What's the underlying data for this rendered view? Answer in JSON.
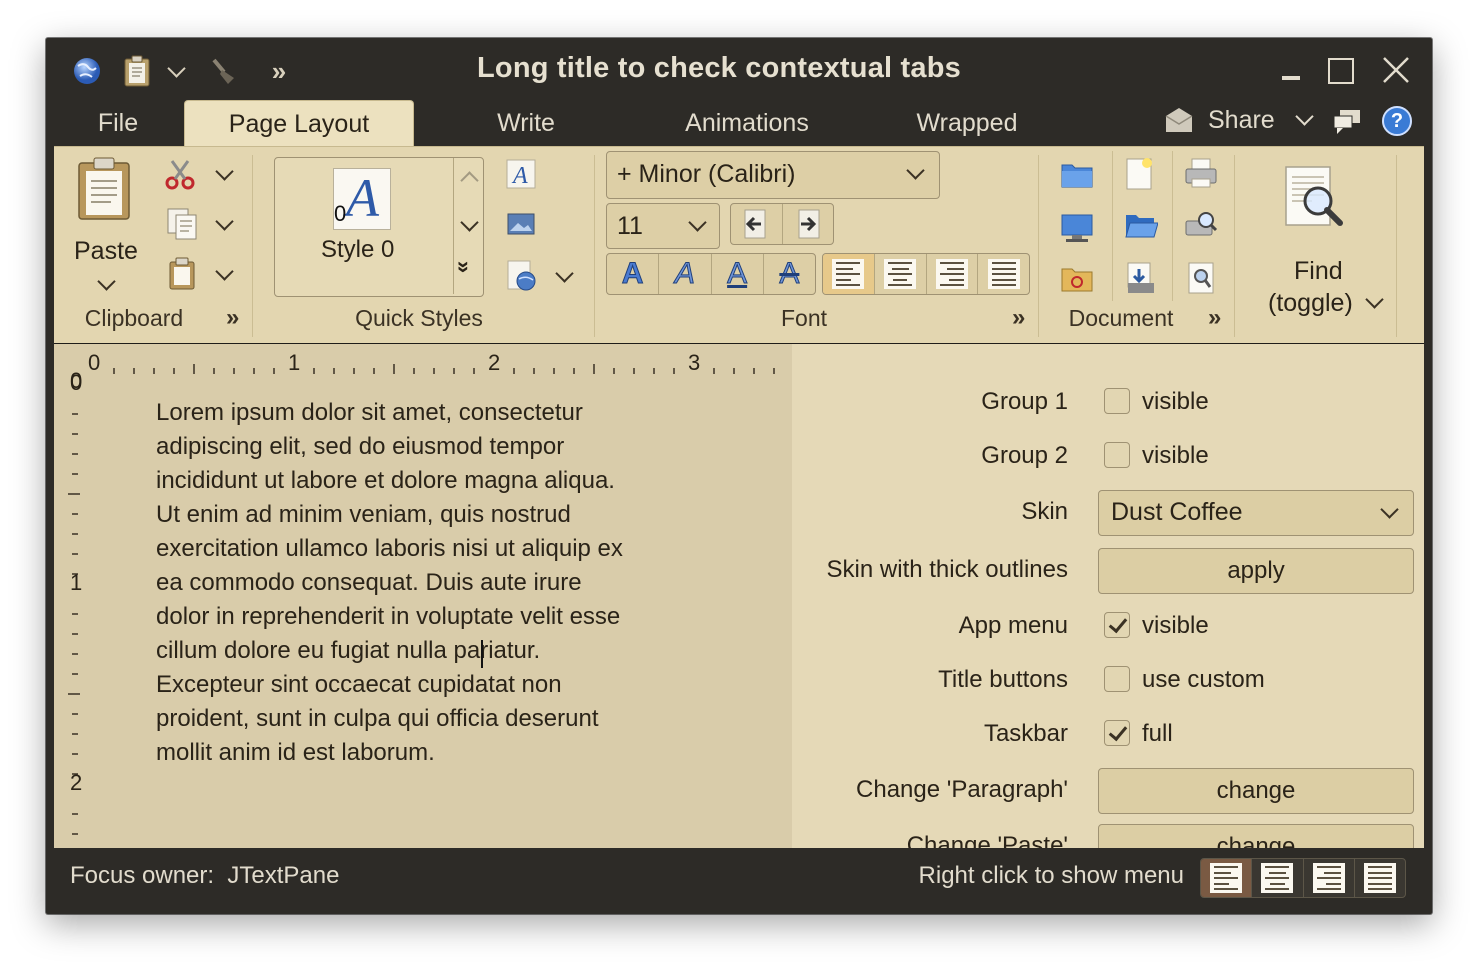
{
  "window": {
    "title": "Long title to check contextual tabs"
  },
  "title_bar": {
    "quick_access": [
      "globe-icon",
      "clipboard-icon",
      "chevron-down-icon",
      "brush-icon",
      "double-chevron-right-icon"
    ],
    "controls": [
      "minimize-icon",
      "maximize-icon",
      "close-icon"
    ]
  },
  "tabs": {
    "app_menu": "File",
    "items": [
      "Page Layout",
      "Write",
      "Animations",
      "Wrapped"
    ],
    "selected": "Page Layout",
    "share": "Share"
  },
  "ribbon": {
    "clipboard": {
      "title": "Clipboard",
      "paste": "Paste"
    },
    "quick_styles": {
      "title": "Quick Styles",
      "style_name": "Style 0",
      "style_index": "0"
    },
    "font": {
      "title": "Font",
      "family": "+ Minor (Calibri)",
      "size": "11"
    },
    "document": {
      "title": "Document"
    },
    "find": {
      "line1": "Find",
      "line2": "(toggle)"
    }
  },
  "ruler": {
    "h_labels": [
      "0",
      "1",
      "2",
      "3"
    ],
    "v_labels": [
      "0",
      "1",
      "2"
    ],
    "corner": "0"
  },
  "editor": {
    "text": "Lorem ipsum dolor sit amet, consectetur adipiscing elit, sed do eiusmod tempor incididunt ut labore et dolore magna aliqua. Ut enim ad minim veniam, quis nostrud exercitation ullamco laboris nisi ut aliquip ex ea commodo consequat. Duis aute irure dolor in reprehenderit in voluptate velit esse cillum dolore eu fugiat nulla pariatur. Excepteur sint occaecat cupidatat non proident, sunt in culpa qui officia deserunt mollit anim id est laborum.",
    "lines": [
      "Lorem ipsum dolor sit amet, consectetur",
      "adipiscing elit, sed do eiusmod tempor",
      "incididunt ut labore et dolore magna aliqua.",
      "Ut enim ad minim veniam, quis nostrud",
      "exercitation ullamco laboris nisi ut aliquip ex",
      "ea commodo consequat. Duis aute irure",
      "dolor in reprehenderit in voluptate velit esse",
      "cillum dolore eu fugiat nulla pariatur.",
      "Excepteur sint occaecat cupidatat non",
      "proident, sunt in culpa qui officia deserunt",
      "mollit anim id est laborum."
    ]
  },
  "panel": {
    "group1": {
      "label": "Group 1",
      "checkbox": "visible",
      "checked": false
    },
    "group2": {
      "label": "Group 2",
      "checkbox": "visible",
      "checked": false
    },
    "skin": {
      "label": "Skin",
      "value": "Dust Coffee"
    },
    "thick": {
      "label": "Skin with thick outlines",
      "button": "apply"
    },
    "app_menu": {
      "label": "App menu",
      "checkbox": "visible",
      "checked": true
    },
    "title_buttons": {
      "label": "Title buttons",
      "checkbox": "use custom",
      "checked": false
    },
    "taskbar": {
      "label": "Taskbar",
      "checkbox": "full",
      "checked": true
    },
    "paragraph": {
      "label": "Change 'Paragraph'",
      "button": "change"
    },
    "paste": {
      "label": "Change 'Paste'",
      "button": "change"
    }
  },
  "status": {
    "focus_label": "Focus owner:",
    "focus_value": "JTextPane",
    "hint": "Right click to show menu",
    "selected_alignment": "left"
  },
  "colors": {
    "frame": "#2d2b27",
    "ribbon": "#e3d6b0",
    "editor": "#d9ccaa",
    "panel": "#e5d9b7",
    "accent": "#e7c98a"
  }
}
